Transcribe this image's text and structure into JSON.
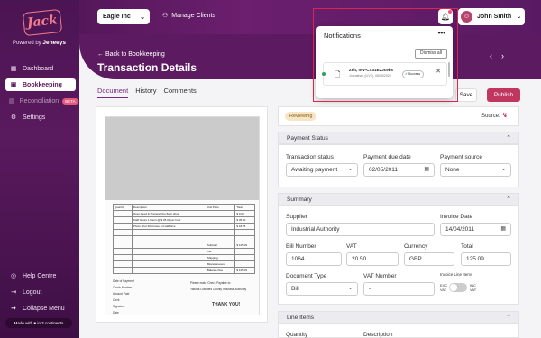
{
  "brand": {
    "logo_text": "Jack",
    "powered_prefix": "Powered by",
    "powered_brand": "Jeneeys"
  },
  "sidebar": {
    "items": [
      {
        "label": "Dashboard",
        "icon": "grid-icon",
        "glyph": "▦"
      },
      {
        "label": "Bookkeeping",
        "icon": "book-icon",
        "glyph": "▣"
      },
      {
        "label": "Reconciliation",
        "icon": "reconcile-icon",
        "glyph": "▤",
        "badge": "BETA"
      },
      {
        "label": "Settings",
        "icon": "gear-icon",
        "glyph": "⚙"
      }
    ],
    "bottom": [
      {
        "label": "Help Centre",
        "icon": "help-icon",
        "glyph": "◎"
      },
      {
        "label": "Logout",
        "icon": "logout-icon",
        "glyph": "⇥"
      },
      {
        "label": "Collapse Menu",
        "icon": "collapse-icon",
        "glyph": "➔"
      }
    ],
    "made_with": "Made with ♥ in 3 continents"
  },
  "topbar": {
    "company": "Eagle Inc",
    "manage_clients": "Manage Clients",
    "user_name": "John Smith"
  },
  "header": {
    "back_link": "Back to Bookkeeping",
    "title": "Transaction Details",
    "tabs": [
      "Document",
      "History",
      "Comments"
    ],
    "save": "Save",
    "publish": "Publish"
  },
  "notifications": {
    "title": "Notifications",
    "dismiss_all": "Dismiss all",
    "item": {
      "title": "Zelt, INV-CXSzE2Jc9bs",
      "subtitle": "Johnathan (LIVE), 08/05/2024",
      "status": "Success"
    }
  },
  "document": {
    "table_headers": [
      "Quantity",
      "Description",
      "Unit Price",
      "Total"
    ],
    "rows": [
      [
        "",
        "Open Feed & Prepare   One flash drive",
        "",
        "$  0.00"
      ],
      [
        "",
        "Staff Hours   1 hours @ $ 35.00 per hour",
        "",
        "$  35.00"
      ],
      [
        "",
        "Photo Shot 30 minutes of staff time",
        "",
        "$  18.25"
      ]
    ],
    "totals": [
      [
        "Subtotal",
        "$  125.09"
      ],
      [
        "Tax",
        ""
      ],
      [
        "Shipping",
        ""
      ],
      [
        "Miscellaneous",
        ""
      ],
      [
        "Balance Due",
        "$  125.09"
      ]
    ],
    "form_lines": [
      "Date of Payment",
      "Check Number",
      "Amount Paid",
      "Clerk",
      "Signature",
      "Date"
    ],
    "payable_line1": "Please make Check Payable to:",
    "payable_line2": "Yakima Lowndes County Industrial Authority",
    "thanks": "THANK YOU!"
  },
  "form": {
    "status_badge": "Reviewing",
    "source_label": "Source:",
    "payment_status": {
      "heading": "Payment Status",
      "transaction_status_label": "Transaction status",
      "transaction_status": "Awaiting payment",
      "due_date_label": "Payment due date",
      "due_date": "02/05/2011",
      "source_label": "Payment source",
      "source": "None"
    },
    "summary": {
      "heading": "Summary",
      "supplier_label": "Supplier",
      "supplier": "Industrial Authority",
      "invoice_date_label": "Invoice Date",
      "invoice_date": "14/04/2011",
      "bill_number_label": "Bill Number",
      "bill_number": "1064",
      "vat_label": "VAT",
      "vat": "20.50",
      "currency_label": "Currency",
      "currency": "GBP",
      "total_label": "Total",
      "total": "125.09",
      "doc_type_label": "Document Type",
      "doc_type": "Bill",
      "vat_number_label": "VAT Number",
      "vat_number": "-",
      "invoice_line_items_label": "Invoice Line Items",
      "toggle_left": "EXC VAT",
      "toggle_right": "INC VAT"
    },
    "line_items": {
      "heading": "Line Items",
      "quantity_label": "Quantity",
      "description_label": "Description"
    }
  }
}
